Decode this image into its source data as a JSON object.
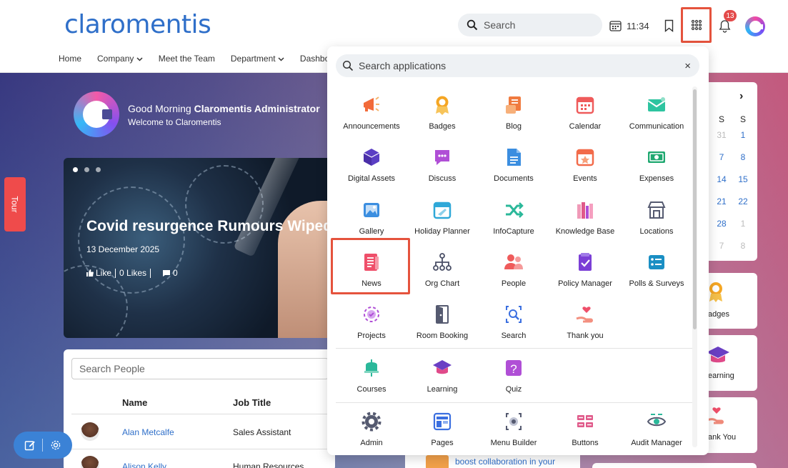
{
  "header": {
    "logo": "claromentis",
    "search_placeholder": "Search",
    "time": "11:34",
    "notification_count": "13",
    "nav": [
      "Home",
      "Company",
      "Meet the Team",
      "Department",
      "Dashbo"
    ]
  },
  "greeting": {
    "prefix": "Good Morning ",
    "name": "Claromentis Administrator",
    "subtitle": "Welcome to Claromentis"
  },
  "tour_label": "Tour",
  "news": {
    "title": "Covid resurgence Rumours Wiped",
    "date": "13 December 2025",
    "like": "Like",
    "likes": "0 Likes",
    "comments": "0"
  },
  "people": {
    "search_placeholder": "Search People",
    "headers": [
      "Name",
      "Job Title"
    ],
    "rows": [
      {
        "name": "Alan Metcalfe",
        "job": "Sales Assistant"
      },
      {
        "name": "Alison Kelly",
        "job": "Human Resources Assistant"
      }
    ]
  },
  "calendar": {
    "headers": [
      "S",
      "S"
    ],
    "weeks": [
      [
        "31",
        "1"
      ],
      [
        "7",
        "8"
      ],
      [
        "14",
        "15"
      ],
      [
        "21",
        "22"
      ],
      [
        "28",
        "1"
      ],
      [
        "7",
        "8"
      ]
    ]
  },
  "side_cards": [
    "adges",
    "earning",
    "ank You"
  ],
  "middle_text": "boost collaboration in your",
  "apps_panel": {
    "search_placeholder": "Search applications",
    "close": "×",
    "sections": [
      [
        {
          "label": "Announcements",
          "icon": "megaphone-icon",
          "color": "#f26b3a"
        },
        {
          "label": "Badges",
          "icon": "badge-icon",
          "color": "#f5a623"
        },
        {
          "label": "Blog",
          "icon": "blog-icon",
          "color": "#f07b3f"
        },
        {
          "label": "Calendar",
          "icon": "calendar-icon",
          "color": "#ef5b5b"
        },
        {
          "label": "Communication",
          "icon": "envelope-icon",
          "color": "#2ec4a0"
        },
        {
          "label": "Digital Assets",
          "icon": "cube-icon",
          "color": "#5b3fc4"
        },
        {
          "label": "Discuss",
          "icon": "chat-icon",
          "color": "#b04fd6"
        },
        {
          "label": "Documents",
          "icon": "document-icon",
          "color": "#3b8ee0"
        },
        {
          "label": "Events",
          "icon": "events-icon",
          "color": "#f26b4a"
        },
        {
          "label": "Expenses",
          "icon": "money-icon",
          "color": "#1fa870"
        },
        {
          "label": "Gallery",
          "icon": "gallery-icon",
          "color": "#3b8ee0"
        },
        {
          "label": "Holiday Planner",
          "icon": "plane-icon",
          "color": "#2fa8d8"
        },
        {
          "label": "InfoCapture",
          "icon": "shuffle-icon",
          "color": "#2bb89a"
        },
        {
          "label": "Knowledge Base",
          "icon": "books-icon",
          "color": "#e05a8a"
        },
        {
          "label": "Locations",
          "icon": "store-icon",
          "color": "#555a70"
        },
        {
          "label": "News",
          "icon": "newspaper-icon",
          "color": "#ef4f6a"
        },
        {
          "label": "Org Chart",
          "icon": "org-chart-icon",
          "color": "#4a4f66"
        },
        {
          "label": "People",
          "icon": "people-icon",
          "color": "#ef5b5b"
        },
        {
          "label": "Policy Manager",
          "icon": "policy-icon",
          "color": "#7b3fd6"
        },
        {
          "label": "Polls & Surveys",
          "icon": "polls-icon",
          "color": "#1a8fc4"
        },
        {
          "label": "Projects",
          "icon": "projects-icon",
          "color": "#b04fd6"
        },
        {
          "label": "Room Booking",
          "icon": "door-icon",
          "color": "#555a70"
        },
        {
          "label": "Search",
          "icon": "search-doc-icon",
          "color": "#3b6fe0"
        },
        {
          "label": "Thank you",
          "icon": "thank-you-icon",
          "color": "#ef4f6a"
        }
      ],
      [
        {
          "label": "Courses",
          "icon": "courses-icon",
          "color": "#2bb89a"
        },
        {
          "label": "Learning",
          "icon": "graduation-cap-icon",
          "color": "#6a3fc4"
        },
        {
          "label": "Quiz",
          "icon": "quiz-icon",
          "color": "#b04fd6"
        }
      ],
      [
        {
          "label": "Admin",
          "icon": "gear-icon",
          "color": "#555a70"
        },
        {
          "label": "Pages",
          "icon": "pages-icon",
          "color": "#3b6fe0"
        },
        {
          "label": "Menu Builder",
          "icon": "menu-builder-icon",
          "color": "#555a70"
        },
        {
          "label": "Buttons",
          "icon": "buttons-icon",
          "color": "#e05a8a"
        },
        {
          "label": "Audit Manager",
          "icon": "audit-icon",
          "color": "#2bb89a"
        }
      ]
    ]
  }
}
